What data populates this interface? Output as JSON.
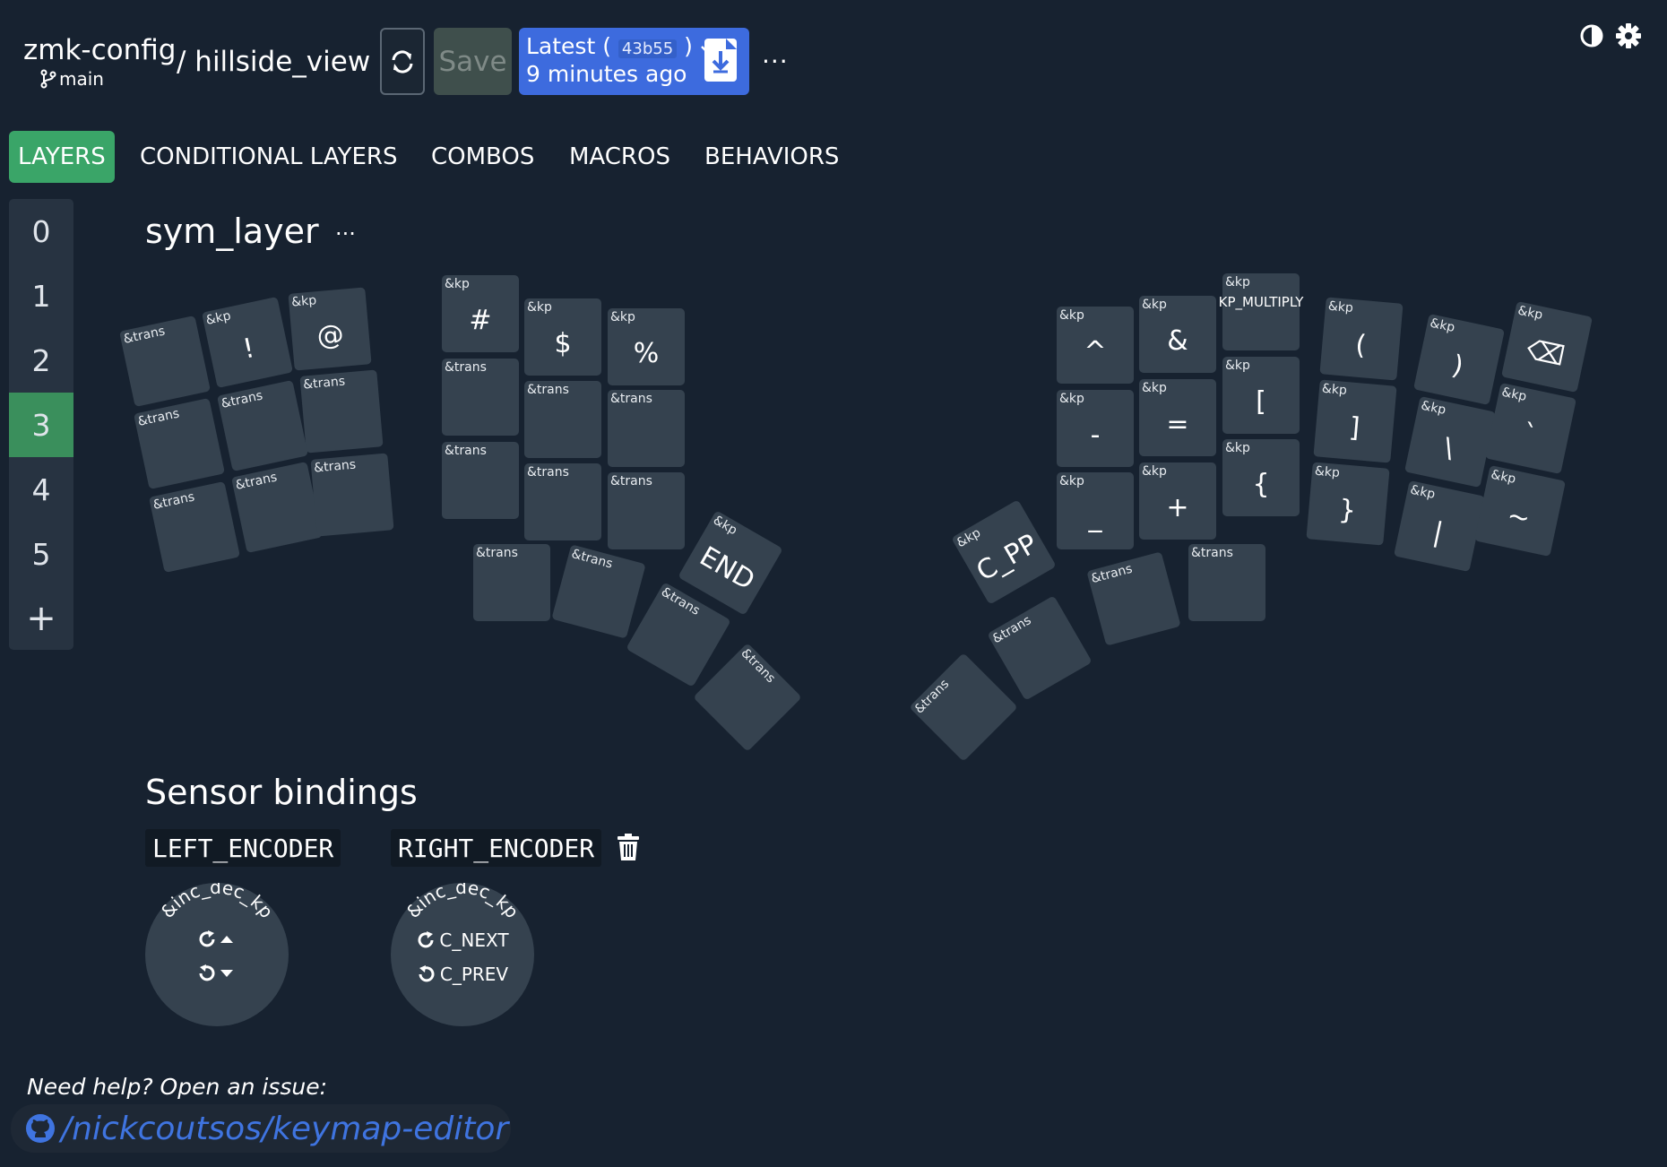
{
  "header": {
    "repo": "zmk-config",
    "branch": "main",
    "keymap_path": "/ hillside_view",
    "save_label": "Save",
    "latest_label": "Latest (",
    "latest_hash": "43b55",
    "latest_close": ")",
    "latest_time": "9 minutes ago",
    "more": "···"
  },
  "tabs": [
    "LAYERS",
    "CONDITIONAL LAYERS",
    "COMBOS",
    "MACROS",
    "BEHAVIORS"
  ],
  "layers": [
    "0",
    "1",
    "2",
    "3",
    "4",
    "5",
    "+"
  ],
  "selected_layer": "3",
  "layer_name": "sym_layer",
  "layer_menu": "···",
  "keys": [
    {
      "b": "&trans",
      "v": ""
    },
    {
      "b": "&kp",
      "v": "!"
    },
    {
      "b": "&kp",
      "v": "@"
    },
    {
      "b": "&kp",
      "v": "#"
    },
    {
      "b": "&kp",
      "v": "$"
    },
    {
      "b": "&kp",
      "v": "%"
    },
    {
      "b": "&trans",
      "v": ""
    },
    {
      "b": "&trans",
      "v": ""
    },
    {
      "b": "&trans",
      "v": ""
    },
    {
      "b": "&trans",
      "v": ""
    },
    {
      "b": "&trans",
      "v": ""
    },
    {
      "b": "&trans",
      "v": ""
    },
    {
      "b": "&trans",
      "v": ""
    },
    {
      "b": "&trans",
      "v": ""
    },
    {
      "b": "&trans",
      "v": ""
    },
    {
      "b": "&trans",
      "v": ""
    },
    {
      "b": "&trans",
      "v": ""
    },
    {
      "b": "&trans",
      "v": ""
    },
    {
      "b": "&kp",
      "v": "END"
    },
    {
      "b": "&trans",
      "v": ""
    },
    {
      "b": "&trans",
      "v": ""
    },
    {
      "b": "&trans",
      "v": ""
    },
    {
      "b": "&trans",
      "v": ""
    },
    {
      "b": "&kp",
      "v": "^"
    },
    {
      "b": "&kp",
      "v": "&"
    },
    {
      "b": "&kp",
      "v": "KP_MULTIPLY"
    },
    {
      "b": "&kp",
      "v": "("
    },
    {
      "b": "&kp",
      "v": ")"
    },
    {
      "b": "&kp",
      "v": "⌫"
    },
    {
      "b": "&kp",
      "v": "-"
    },
    {
      "b": "&kp",
      "v": "="
    },
    {
      "b": "&kp",
      "v": "["
    },
    {
      "b": "&kp",
      "v": "]"
    },
    {
      "b": "&kp",
      "v": "\\"
    },
    {
      "b": "&kp",
      "v": "`"
    },
    {
      "b": "&kp",
      "v": "_"
    },
    {
      "b": "&kp",
      "v": "+"
    },
    {
      "b": "&kp",
      "v": "{"
    },
    {
      "b": "&kp",
      "v": "}"
    },
    {
      "b": "&kp",
      "v": "|"
    },
    {
      "b": "&kp",
      "v": "~"
    },
    {
      "b": "&kp",
      "v": "C_PP"
    },
    {
      "b": "&trans",
      "v": ""
    },
    {
      "b": "&trans",
      "v": ""
    },
    {
      "b": "&trans",
      "v": ""
    },
    {
      "b": "&trans",
      "v": ""
    }
  ],
  "sensors": {
    "title": "Sensor bindings",
    "left": {
      "name": "LEFT_ENCODER",
      "behavior": "&inc_dec_kp",
      "cw": "",
      "ccw": ""
    },
    "right": {
      "name": "RIGHT_ENCODER",
      "behavior": "&inc_dec_kp",
      "cw": "C_NEXT",
      "ccw": "C_PREV"
    }
  },
  "footer": {
    "help": "Need help? Open an issue:",
    "link": "/nickcoutsos/keymap-editor"
  },
  "colors": {
    "background": "#172230",
    "key": "#35424f",
    "active_tab": "#3aa568",
    "selected_layer": "#3a8f5c",
    "primary": "#3d6bde",
    "link": "#3f74e0"
  },
  "icons": [
    "branch-icon",
    "reload-icon",
    "check-icon",
    "download-icon",
    "theme-icon",
    "gear-icon",
    "backspace-icon",
    "trash-icon",
    "rotate-cw-icon",
    "rotate-ccw-icon",
    "caret-up-icon",
    "caret-down-icon",
    "github-icon"
  ]
}
